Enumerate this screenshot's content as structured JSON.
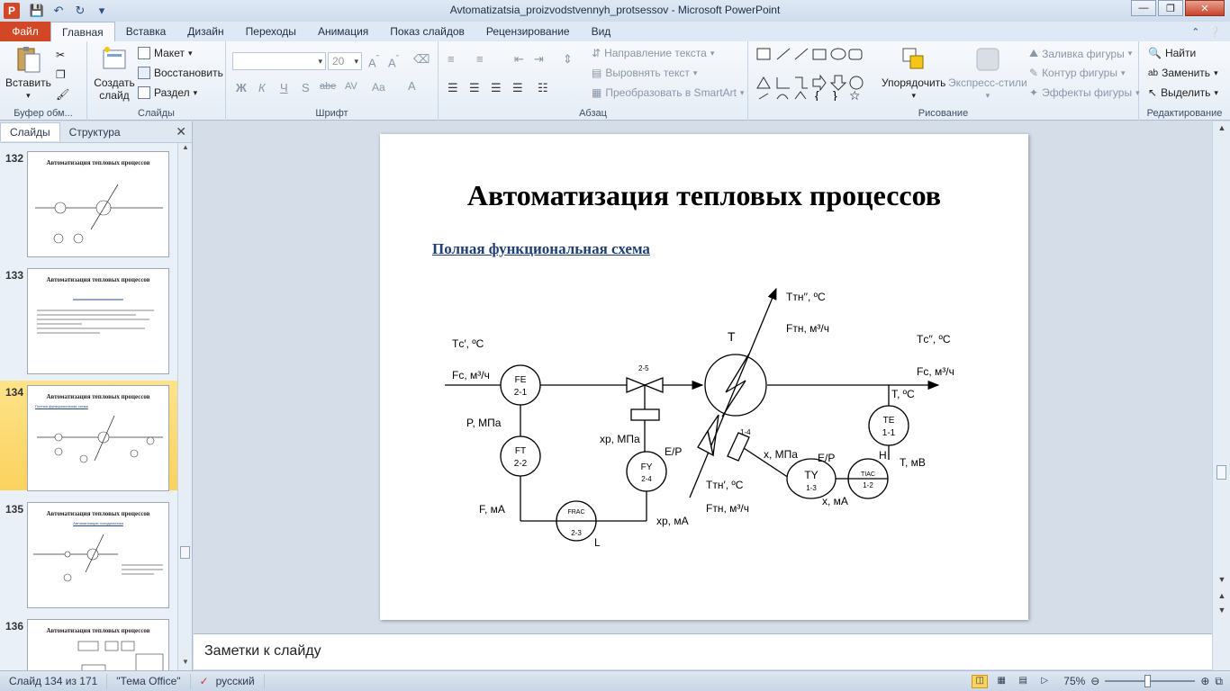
{
  "window": {
    "title": "Avtomatizatsia_proizvodstvennyh_protsessov  -  Microsoft PowerPoint",
    "app_icon": "P"
  },
  "tabs": {
    "file": "Файл",
    "items": [
      "Главная",
      "Вставка",
      "Дизайн",
      "Переходы",
      "Анимация",
      "Показ слайдов",
      "Рецензирование",
      "Вид"
    ],
    "active_index": 0
  },
  "ribbon": {
    "clipboard": {
      "paste": "Вставить",
      "group": "Буфер обм..."
    },
    "slides": {
      "new_slide": "Создать слайд",
      "layout": "Макет",
      "reset": "Восстановить",
      "section": "Раздел",
      "group": "Слайды"
    },
    "font": {
      "name": "",
      "size": "20",
      "group": "Шрифт",
      "bold": "Ж",
      "italic": "К",
      "underline": "Ч",
      "shadow": "S",
      "strike": "abe",
      "spacing": "AV",
      "case": "Aa",
      "color": "A"
    },
    "paragraph": {
      "text_direction": "Направление текста",
      "align_text": "Выровнять текст",
      "smartart": "Преобразовать в SmartArt",
      "group": "Абзац"
    },
    "drawing": {
      "arrange": "Упорядочить",
      "quick_styles": "Экспресс-стили",
      "fill": "Заливка фигуры",
      "outline": "Контур фигуры",
      "effects": "Эффекты фигуры",
      "group": "Рисование"
    },
    "editing": {
      "find": "Найти",
      "replace": "Заменить",
      "select": "Выделить",
      "group": "Редактирование"
    }
  },
  "left_pane": {
    "tabs": [
      "Слайды",
      "Структура"
    ],
    "thumbnails": [
      {
        "num": "132",
        "title": "Автоматизация тепловых процессов",
        "sub": "",
        "lines": []
      },
      {
        "num": "133",
        "title": "Автоматизация тепловых процессов",
        "sub": "",
        "lines": []
      },
      {
        "num": "134",
        "title": "Автоматизация тепловых процессов",
        "sub": "Полная функциональная схема",
        "lines": []
      },
      {
        "num": "135",
        "title": "Автоматизация тепловых процессов",
        "sub": "Автоматизация холодильника",
        "lines": []
      },
      {
        "num": "136",
        "title": "Автоматизация тепловых процессов",
        "sub": "",
        "lines": []
      }
    ]
  },
  "slide": {
    "title": "Автоматизация тепловых процессов",
    "subtitle": "Полная функциональная схема",
    "labels": {
      "Tc1": "Tс′, ºC",
      "Fc1": "Fс, м³/ч",
      "Tc2": "Tс′′, ºC",
      "Fc2": "Fс, м³/ч",
      "Ttn_top": "Tтн′′, ºC",
      "Ftn_top": "Fтн, м³/ч",
      "Ttn_bot": "Tтн′, ºC",
      "Ftn_bot": "Fтн, м³/ч",
      "T_label": "T",
      "T_C": "T, ºC",
      "P_MPa": "P, МПа",
      "F_mA": "F, мА",
      "xp_MPa": "xр, МПа",
      "xp_mA": "xр, мА",
      "x_MPa": "x, МПа",
      "x_mA": "x, мА",
      "EP1": "E/P",
      "EP2": "E/P",
      "H": "H",
      "T_mV": "T, мВ",
      "L": "L",
      "valve1": "2-5",
      "valve2": "1-4",
      "FE": "FE",
      "FE_id": "2-1",
      "FT": "FT",
      "FT_id": "2-2",
      "FY": "FY",
      "FY_id": "2-4",
      "FRAC": "FRAC",
      "FRAC_id": "2-3",
      "TE": "TE",
      "TE_id": "1-1",
      "TY": "TY",
      "TY_id": "1-3",
      "TIAC": "TIAC",
      "TIAC_id": "1-2"
    }
  },
  "notes": {
    "placeholder": "Заметки к слайду"
  },
  "status": {
    "slide": "Слайд 134 из 171",
    "theme": "\"Тема Office\"",
    "language": "русский",
    "zoom": "75%"
  }
}
